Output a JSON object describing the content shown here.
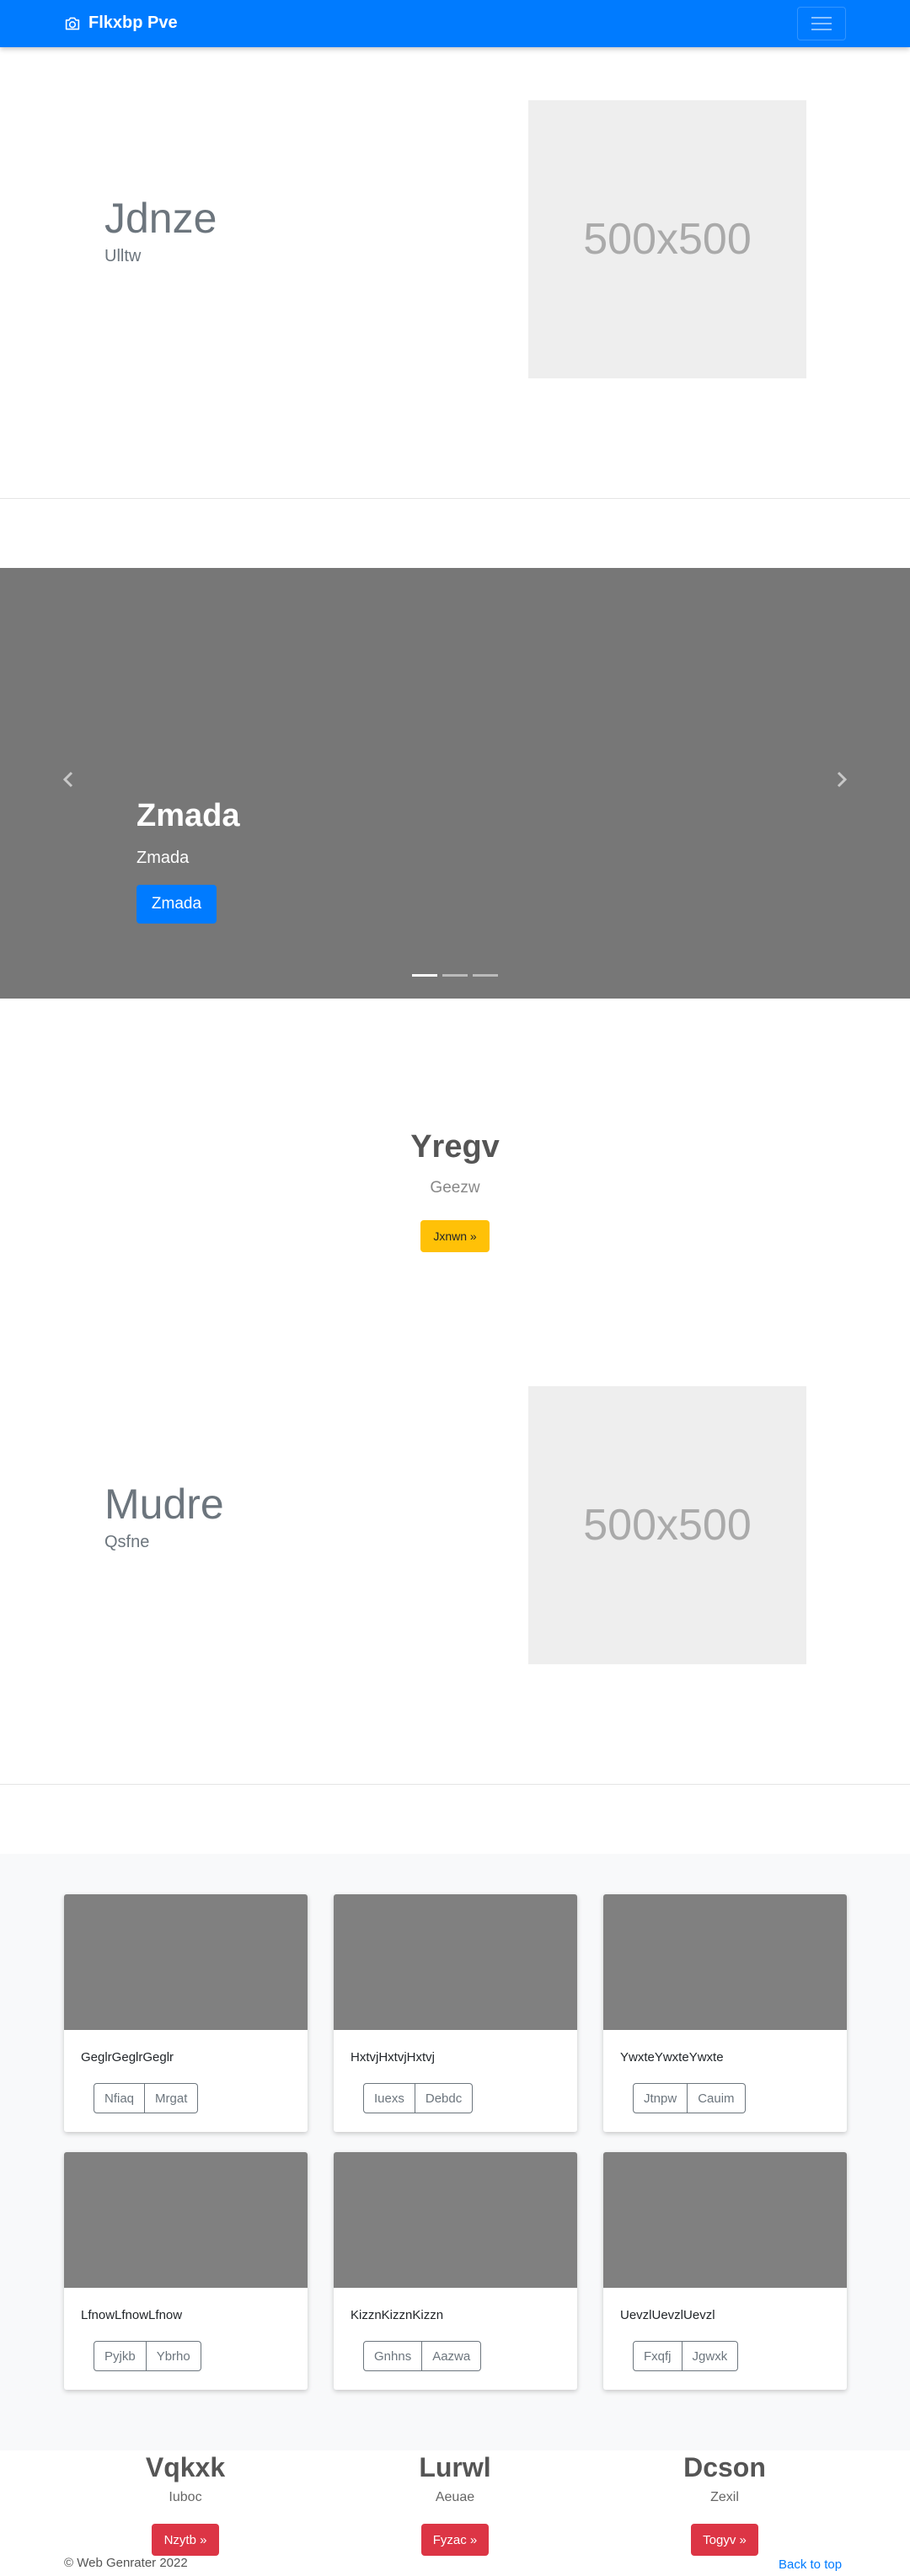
{
  "navbar": {
    "brand": "Flkxbp Pve",
    "icons": {
      "brand": "camera-icon",
      "toggler": "hamburger-icon"
    }
  },
  "feature1": {
    "title": "Jdnze",
    "lead": "Ulltw",
    "image_label": "500x500"
  },
  "carousel": {
    "title": "Zmada",
    "subtitle": "Zmada",
    "button": "Zmada",
    "slide_count": 3,
    "active_slide": 1,
    "icons": {
      "prev": "chevron-left-icon",
      "next": "chevron-right-icon"
    }
  },
  "hero": {
    "title": "Yregv",
    "subtitle": "Geezw",
    "button": "Jxnwn »"
  },
  "feature2": {
    "title": "Mudre",
    "lead": "Qsfne",
    "image_label": "500x500"
  },
  "album": {
    "cards": [
      {
        "text": "GeglrGeglrGeglr",
        "btn1": "Nfiaq",
        "btn2": "Mrgat"
      },
      {
        "text": "HxtvjHxtvjHxtvj",
        "btn1": "Iuexs",
        "btn2": "Debdc"
      },
      {
        "text": "YwxteYwxteYwxte",
        "btn1": "Jtnpw",
        "btn2": "Cauim"
      },
      {
        "text": "LfnowLfnowLfnow",
        "btn1": "Pyjkb",
        "btn2": "Ybrho"
      },
      {
        "text": "KizznKizznKizzn",
        "btn1": "Gnhns",
        "btn2": "Aazwa"
      },
      {
        "text": "UevzlUevzlUevzl",
        "btn1": "Fxqfj",
        "btn2": "Jgwxk"
      }
    ]
  },
  "columns": [
    {
      "title": "Vqkxk",
      "sub": "Iuboc",
      "button": "Nzytb »"
    },
    {
      "title": "Lurwl",
      "sub": "Aeuae",
      "button": "Fyzac »"
    },
    {
      "title": "Dcson",
      "sub": "Zexil",
      "button": "Togyv »"
    }
  ],
  "footer": {
    "copyright": "© Web Genrater 2022",
    "back_to_top": "Back to top"
  },
  "colors": {
    "primary": "#007bff",
    "warning": "#ffc107",
    "danger": "#dc3545",
    "placeholder": "#eeeeee",
    "carousel_bg": "#777777",
    "thumb_bg": "#808080"
  }
}
